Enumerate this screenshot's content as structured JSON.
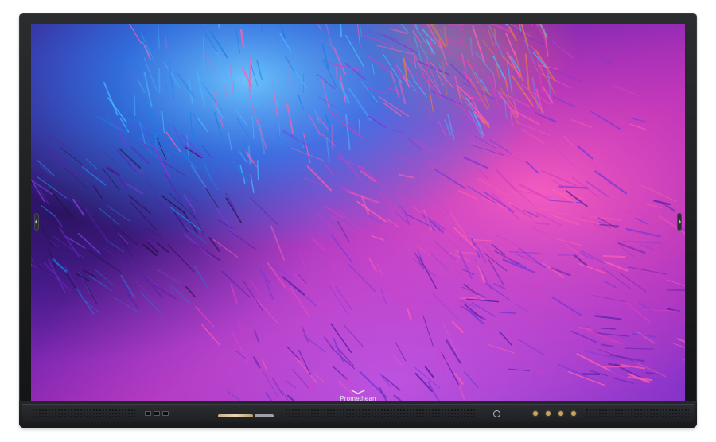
{
  "device": {
    "brand_name": "Promethean",
    "type_icon": "interactive-display-icon",
    "bezel_color": "#1b1c1e",
    "screen_palette": [
      "#2a1250",
      "#5a1fa8",
      "#1e7fe6",
      "#48b4ff",
      "#d43fc0",
      "#ff5fb0",
      "#7b3ad6",
      "#e27a4a"
    ],
    "accent_button_color": "#c8a55c"
  },
  "controls": {
    "left_handle_icon": "chevron-left-icon",
    "right_handle_icon": "chevron-right-icon",
    "power_icon": "power-icon",
    "button_icons": [
      "menu-button-icon",
      "home-button-icon",
      "volume-button-icon",
      "input-button-icon"
    ]
  }
}
